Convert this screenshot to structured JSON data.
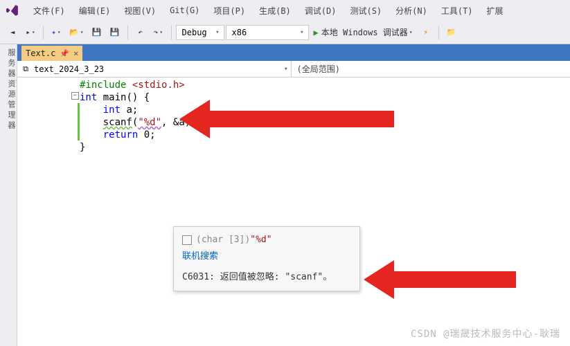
{
  "menubar": {
    "items": [
      "文件(F)",
      "编辑(E)",
      "视图(V)",
      "Git(G)",
      "项目(P)",
      "生成(B)",
      "调试(D)",
      "测试(S)",
      "分析(N)",
      "工具(T)",
      "扩展"
    ]
  },
  "toolbar": {
    "config": "Debug",
    "platform": "x86",
    "run_label": "本地 Windows 调试器"
  },
  "sidepanel": {
    "label": "服务器资源管理器"
  },
  "tab": {
    "filename": "Text.c"
  },
  "nav": {
    "left": "text_2024_3_23",
    "right": "(全局范围)"
  },
  "code": {
    "l1_pre": "#include ",
    "l1_inc": "<stdio.h>",
    "l2_kw": "int ",
    "l2_fn": "main",
    "l2_rest": "() {",
    "l3_kw": "    int ",
    "l3_rest": "a;",
    "l4_pre": "    ",
    "l4_fn": "scanf",
    "l4_open": "(",
    "l4_fmt": "\"%d\"",
    "l4_mid": ", &a)",
    "l4_end": ";",
    "l4_cursor": "|",
    "l5_kw": "    return ",
    "l5_num": "0",
    "l5_end": ";",
    "l6": "}"
  },
  "tooltip": {
    "type_info": "(char [3])",
    "value": "\"%d\"",
    "search_link": "联机搜索",
    "warning": "C6031: 返回值被忽略: \"scanf\"。"
  },
  "watermark": "CSDN @瑞晟技术服务中心-耿瑞"
}
